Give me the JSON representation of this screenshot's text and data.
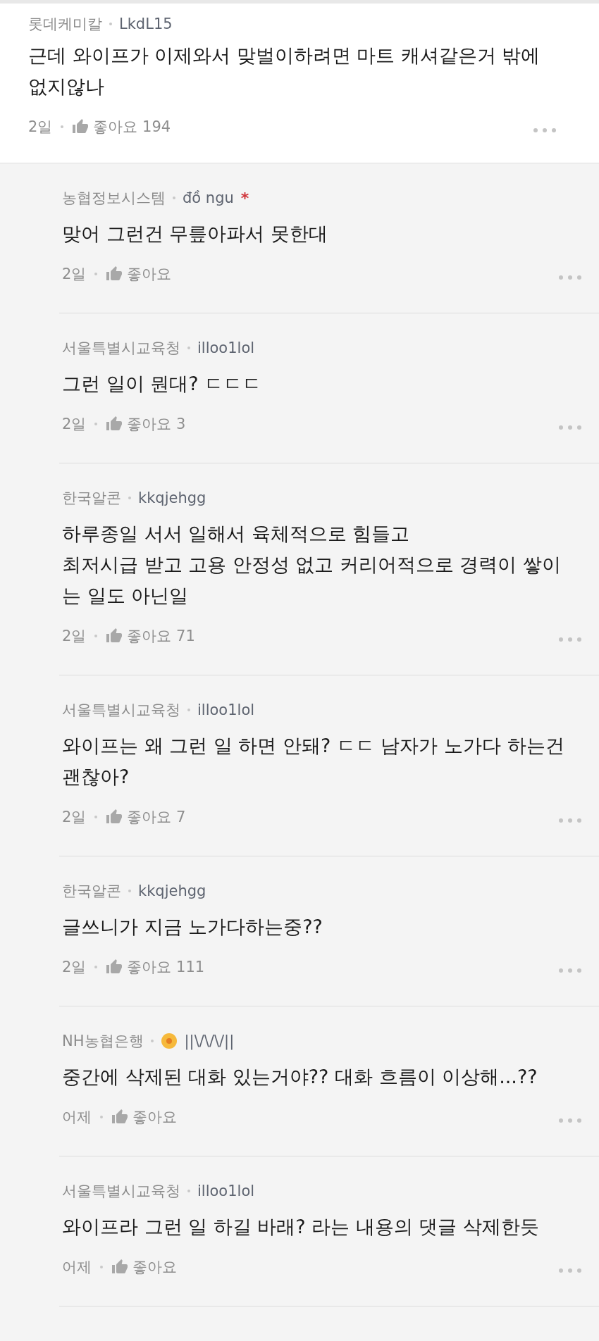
{
  "comment": {
    "org": "롯데케미칼",
    "user": "LkdL15",
    "text": "근데 와이프가 이제와서 맞벌이하려면 마트 캐셔같은거 밖에 없지않나",
    "time": "2일",
    "like_label": "좋아요",
    "like_count": "194"
  },
  "replies": [
    {
      "org": "농협정보시스템",
      "user": "đồ ngu",
      "user_mark": "*",
      "flower_icon": false,
      "text": "맞어 그런건 무릎아파서 못한대",
      "time": "2일",
      "like_label": "좋아요"
    },
    {
      "org": "서울특별시교육청",
      "user": "illoo1lol",
      "flower_icon": false,
      "text": "그런 일이 뭔대? ㄷㄷㄷ",
      "time": "2일",
      "like_label": "좋아요",
      "like_count": "3"
    },
    {
      "org": "한국알콘",
      "user": "kkqjehgg",
      "flower_icon": false,
      "text": "하루종일 서서 일해서 육체적으로 힘들고\n최저시급 받고 고용 안정성 없고 커리어적으로 경력이 쌓이는 일도 아닌일",
      "time": "2일",
      "like_label": "좋아요",
      "like_count": "71"
    },
    {
      "org": "서울특별시교육청",
      "user": "illoo1lol",
      "flower_icon": false,
      "text": "와이프는 왜 그런 일 하면 안돼? ㄷㄷ 남자가 노가다 하는건 괜찮아?",
      "time": "2일",
      "like_label": "좋아요",
      "like_count": "7"
    },
    {
      "org": "한국알콘",
      "user": "kkqjehgg",
      "flower_icon": false,
      "text": "글쓰니가 지금 노가다하는중??",
      "time": "2일",
      "like_label": "좋아요",
      "like_count": "111"
    },
    {
      "org": "NH농협은행",
      "user": "||\\/\\/\\/||",
      "flower_icon": true,
      "text": "중간에 삭제된 대화 있는거야?? 대화 흐름이 이상해...??",
      "time": "어제",
      "like_label": "좋아요"
    },
    {
      "org": "서울특별시교육청",
      "user": "illoo1lol",
      "flower_icon": false,
      "text": "와이프라 그런 일 하길 바래? 라는 내용의 댓글 삭제한듯",
      "time": "어제",
      "like_label": "좋아요"
    }
  ]
}
